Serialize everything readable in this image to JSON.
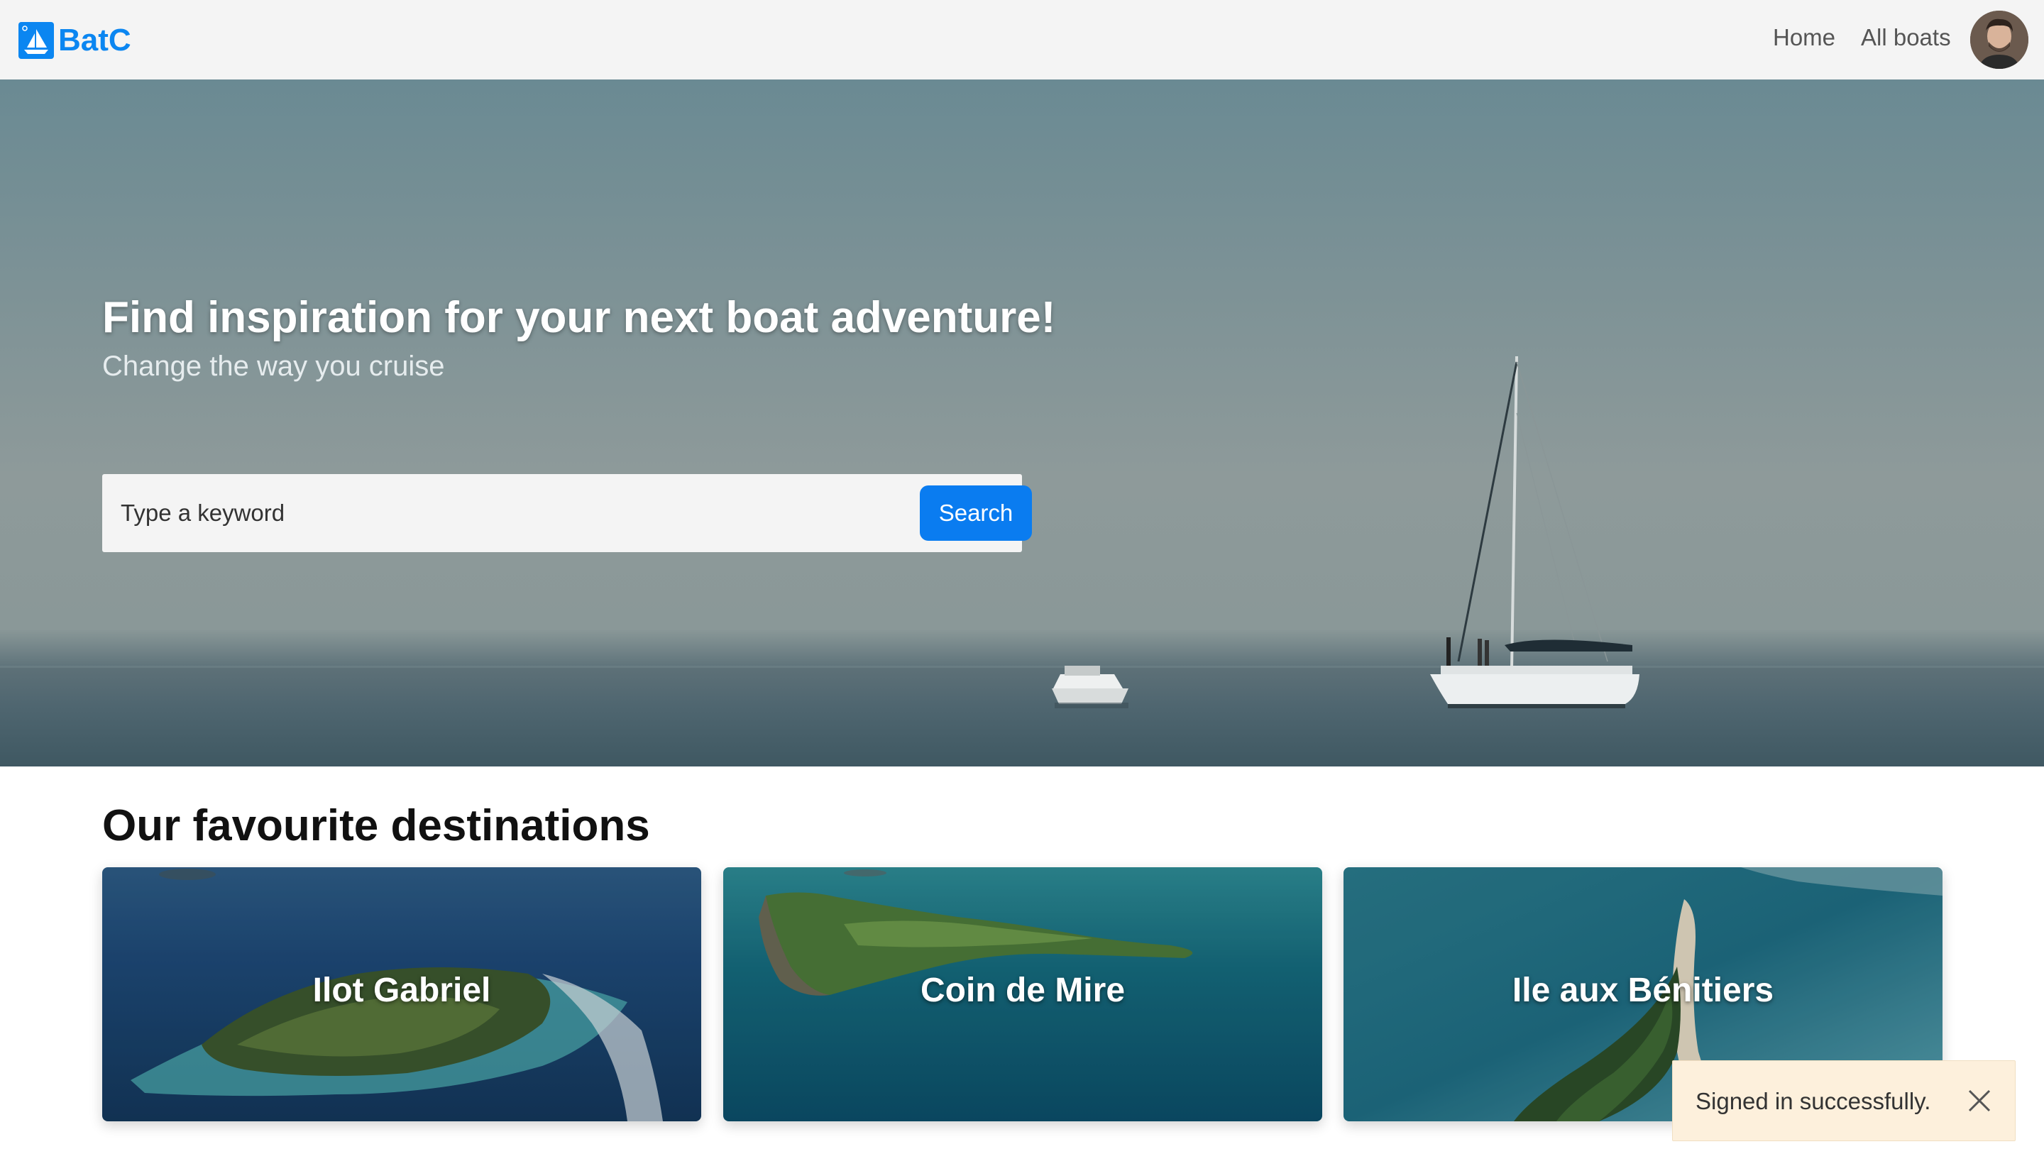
{
  "brand": {
    "name": "BatC",
    "logo_icon": "sailboat-icon",
    "color": "#0b86f1"
  },
  "nav": {
    "home_label": "Home",
    "all_boats_label": "All boats",
    "avatar_icon": "user-avatar"
  },
  "hero": {
    "title": "Find inspiration for your next boat adventure!",
    "subtitle": "Change the way you cruise",
    "search": {
      "placeholder": "Type a keyword",
      "button_label": "Search",
      "button_color": "#0a7cf0"
    }
  },
  "destinations": {
    "title": "Our favourite destinations",
    "items": [
      {
        "name": "Ilot Gabriel"
      },
      {
        "name": "Coin de Mire"
      },
      {
        "name": "Ile aux Bénitiers"
      }
    ]
  },
  "toast": {
    "message": "Signed in successfully.",
    "close_icon": "close-icon",
    "background": "#fdf0dc"
  }
}
